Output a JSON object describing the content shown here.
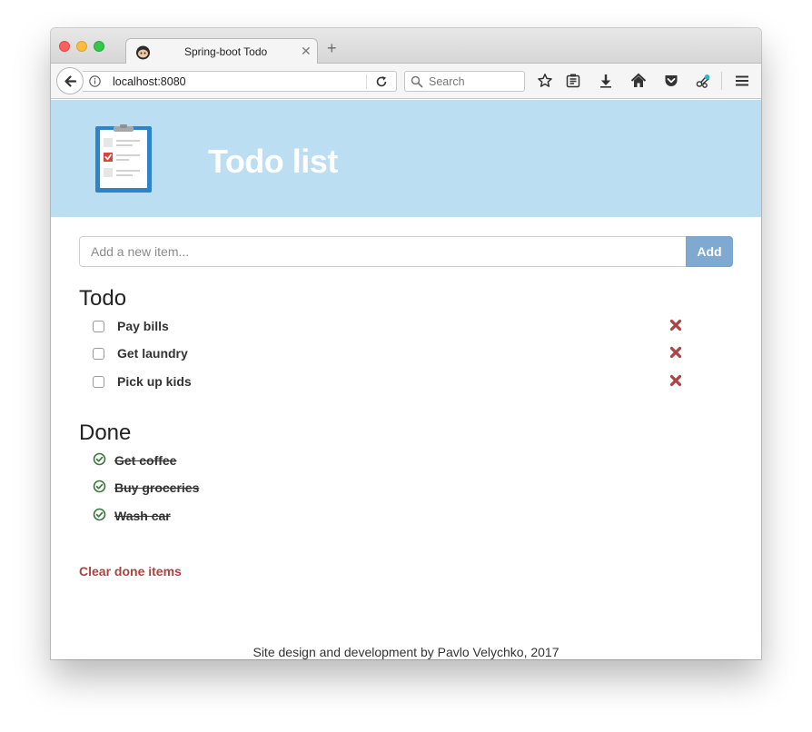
{
  "browser": {
    "tab_title": "Spring-boot Todo",
    "url": "localhost:8080",
    "search_placeholder": "Search"
  },
  "app": {
    "title": "Todo list",
    "add_placeholder": "Add a new item...",
    "add_label": "Add"
  },
  "todo": {
    "heading": "Todo",
    "items": [
      {
        "label": "Pay bills"
      },
      {
        "label": "Get laundry"
      },
      {
        "label": "Pick up kids"
      }
    ]
  },
  "done": {
    "heading": "Done",
    "items": [
      {
        "label": "Get coffee"
      },
      {
        "label": "Buy groceries"
      },
      {
        "label": "Wash car"
      }
    ],
    "clear_label": "Clear done items"
  },
  "footer": {
    "text": "Site design and development by Pavlo Velychko, 2017"
  },
  "colors": {
    "header_band": "#bbdef3",
    "add_button": "#7fa9d0",
    "delete": "#a94442",
    "done_check": "#3c763d",
    "clear_link": "#a94442"
  },
  "icons": {
    "logo": "clipboard-checklist-icon",
    "delete": "times-icon",
    "done": "check-circle-icon"
  }
}
